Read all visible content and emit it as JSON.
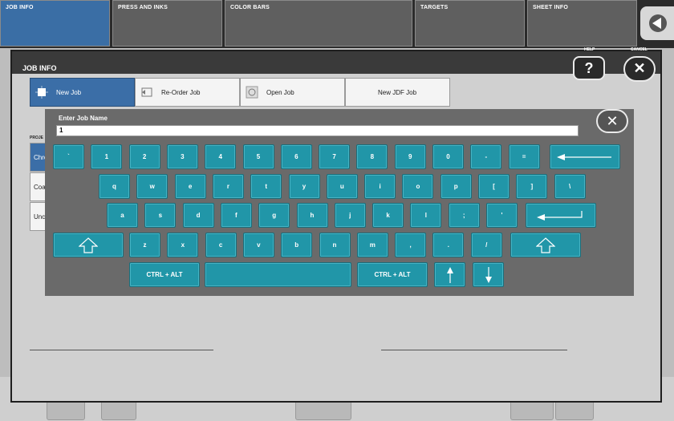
{
  "top_tabs": [
    {
      "label": "JOB INFO",
      "active": true
    },
    {
      "label": "PRESS AND INKS",
      "active": false
    },
    {
      "label": "COLOR BARS",
      "active": false
    },
    {
      "label": "TARGETS",
      "active": false
    },
    {
      "label": "SHEET INFO",
      "active": false
    }
  ],
  "dialog": {
    "title": "JOB INFO",
    "help_label": "HELP",
    "cancel_label": "CANCEL",
    "help_glyph": "?",
    "close_glyph": "✕"
  },
  "job_buttons": [
    {
      "label": "New Job",
      "active": true,
      "icon": "new-job-icon"
    },
    {
      "label": "Re-Order Job",
      "active": false,
      "icon": "reorder-icon"
    },
    {
      "label": "Open Job",
      "active": false,
      "icon": "open-job-icon"
    },
    {
      "label": "New JDF Job",
      "active": false,
      "icon": ""
    }
  ],
  "project": {
    "label": "PROJE",
    "items": [
      "Chro",
      "Coa",
      "Unc"
    ]
  },
  "keyboard": {
    "title": "Enter Job Name",
    "input_value": "1",
    "close_glyph": "✕",
    "row1": [
      "`",
      "1",
      "2",
      "3",
      "4",
      "5",
      "6",
      "7",
      "8",
      "9",
      "0",
      "-",
      "="
    ],
    "row2": [
      "q",
      "w",
      "e",
      "r",
      "t",
      "y",
      "u",
      "i",
      "o",
      "p",
      "[",
      "]",
      "\\"
    ],
    "row3": [
      "a",
      "s",
      "d",
      "f",
      "g",
      "h",
      "j",
      "k",
      "l",
      ";",
      "'"
    ],
    "row4": [
      "z",
      "x",
      "c",
      "v",
      "b",
      "n",
      "m",
      ",",
      ".",
      "/"
    ],
    "ctrl_alt_label": "CTRL + ALT",
    "accent_color": "#2196a8"
  }
}
